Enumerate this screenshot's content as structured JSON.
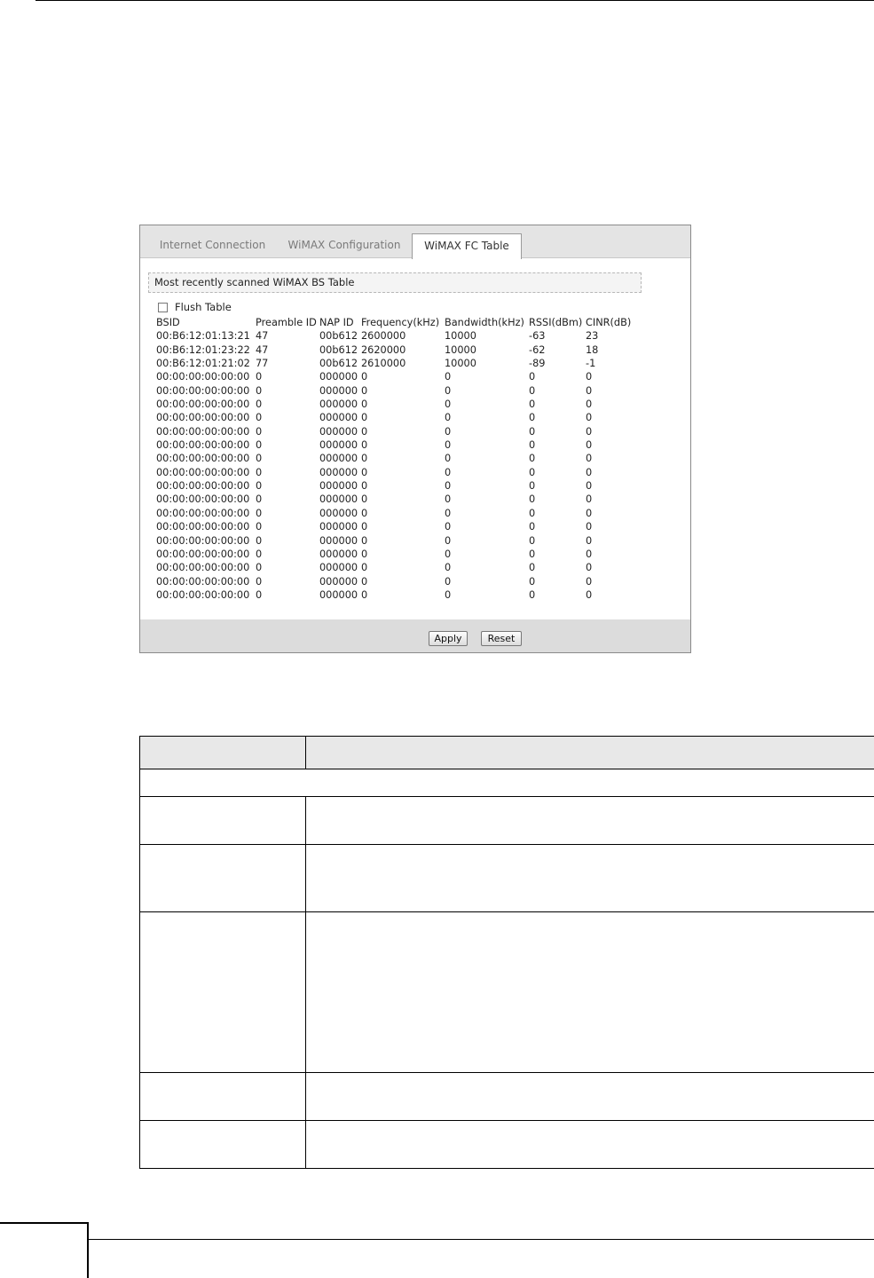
{
  "tabs": [
    {
      "label": "Internet Connection"
    },
    {
      "label": "WiMAX Configuration"
    },
    {
      "label": "WiMAX FC Table"
    }
  ],
  "section_title": "Most recently scanned WiMAX BS Table",
  "flush_label": "Flush Table",
  "table": {
    "headers": [
      "BSID",
      "Preamble ID",
      "NAP ID",
      "Frequency(kHz)",
      "Bandwidth(kHz)",
      "RSSI(dBm)",
      "CINR(dB)"
    ],
    "rows": [
      [
        "00:B6:12:01:13:21",
        "47",
        "00b612",
        "2600000",
        "10000",
        "-63",
        "23"
      ],
      [
        "00:B6:12:01:23:22",
        "47",
        "00b612",
        "2620000",
        "10000",
        "-62",
        "18"
      ],
      [
        "00:B6:12:01:21:02",
        "77",
        "00b612",
        "2610000",
        "10000",
        "-89",
        "-1"
      ],
      [
        "00:00:00:00:00:00",
        "0",
        "000000",
        "0",
        "0",
        "0",
        "0"
      ],
      [
        "00:00:00:00:00:00",
        "0",
        "000000",
        "0",
        "0",
        "0",
        "0"
      ],
      [
        "00:00:00:00:00:00",
        "0",
        "000000",
        "0",
        "0",
        "0",
        "0"
      ],
      [
        "00:00:00:00:00:00",
        "0",
        "000000",
        "0",
        "0",
        "0",
        "0"
      ],
      [
        "00:00:00:00:00:00",
        "0",
        "000000",
        "0",
        "0",
        "0",
        "0"
      ],
      [
        "00:00:00:00:00:00",
        "0",
        "000000",
        "0",
        "0",
        "0",
        "0"
      ],
      [
        "00:00:00:00:00:00",
        "0",
        "000000",
        "0",
        "0",
        "0",
        "0"
      ],
      [
        "00:00:00:00:00:00",
        "0",
        "000000",
        "0",
        "0",
        "0",
        "0"
      ],
      [
        "00:00:00:00:00:00",
        "0",
        "000000",
        "0",
        "0",
        "0",
        "0"
      ],
      [
        "00:00:00:00:00:00",
        "0",
        "000000",
        "0",
        "0",
        "0",
        "0"
      ],
      [
        "00:00:00:00:00:00",
        "0",
        "000000",
        "0",
        "0",
        "0",
        "0"
      ],
      [
        "00:00:00:00:00:00",
        "0",
        "000000",
        "0",
        "0",
        "0",
        "0"
      ],
      [
        "00:00:00:00:00:00",
        "0",
        "000000",
        "0",
        "0",
        "0",
        "0"
      ],
      [
        "00:00:00:00:00:00",
        "0",
        "000000",
        "0",
        "0",
        "0",
        "0"
      ],
      [
        "00:00:00:00:00:00",
        "0",
        "000000",
        "0",
        "0",
        "0",
        "0"
      ],
      [
        "00:00:00:00:00:00",
        "0",
        "000000",
        "0",
        "0",
        "0",
        "0"
      ],
      [
        "00:00:00:00:00:00",
        "0",
        "000000",
        "0",
        "0",
        "0",
        "0"
      ]
    ]
  },
  "buttons": {
    "apply": "Apply",
    "reset": "Reset"
  }
}
